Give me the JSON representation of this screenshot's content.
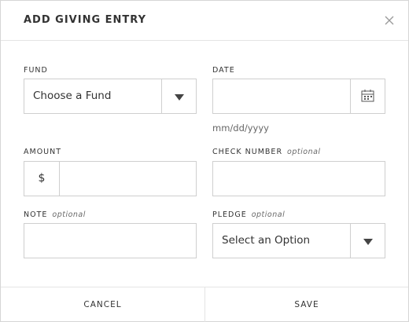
{
  "header": {
    "title": "ADD GIVING ENTRY",
    "close_icon": "close-icon"
  },
  "fund": {
    "label": "FUND",
    "selected": "Choose a Fund",
    "arrow_icon": "chevron-down-icon"
  },
  "date": {
    "label": "DATE",
    "value": "",
    "hint": "mm/dd/yyyy",
    "icon": "calendar-icon"
  },
  "amount": {
    "label": "AMOUNT",
    "currency_symbol": "$",
    "value": ""
  },
  "check_number": {
    "label": "CHECK NUMBER",
    "optional": "optional",
    "value": ""
  },
  "note": {
    "label": "NOTE",
    "optional": "optional",
    "value": ""
  },
  "pledge": {
    "label": "PLEDGE",
    "optional": "optional",
    "selected": "Select an Option",
    "arrow_icon": "chevron-down-icon"
  },
  "footer": {
    "cancel_label": "CANCEL",
    "save_label": "SAVE"
  }
}
